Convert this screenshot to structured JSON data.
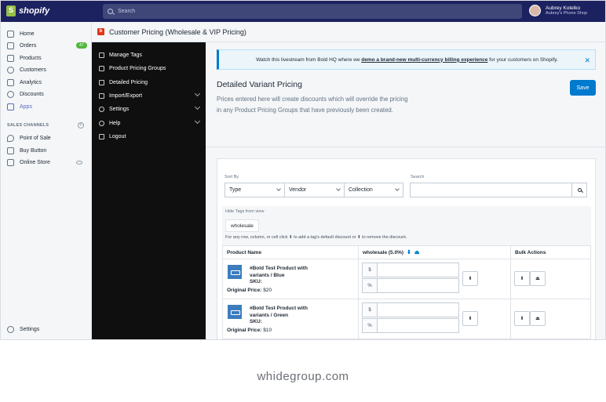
{
  "topbar": {
    "brand": "shopify",
    "search_placeholder": "Search",
    "user_name": "Aubrey Kotelko",
    "user_shop": "Aubrey's Phone Shop"
  },
  "nav": {
    "items": [
      {
        "label": "Home"
      },
      {
        "label": "Orders",
        "badge": "47"
      },
      {
        "label": "Products"
      },
      {
        "label": "Customers"
      },
      {
        "label": "Analytics"
      },
      {
        "label": "Discounts"
      },
      {
        "label": "Apps"
      }
    ],
    "channels_heading": "SALES CHANNELS",
    "channels": [
      {
        "label": "Point of Sale"
      },
      {
        "label": "Buy Button"
      },
      {
        "label": "Online Store"
      }
    ],
    "settings": "Settings"
  },
  "app": {
    "title": "Customer Pricing (Wholesale & VIP Pricing)",
    "icon_letter": "b"
  },
  "sidebar": {
    "items": [
      {
        "label": "Manage Tags"
      },
      {
        "label": "Product Pricing Groups"
      },
      {
        "label": "Detailed Pricing"
      },
      {
        "label": "Import/Export"
      },
      {
        "label": "Settings"
      },
      {
        "label": "Help"
      },
      {
        "label": "Logout"
      }
    ]
  },
  "banner": {
    "prefix": "Watch this livestream from Bold HQ where we ",
    "link": "demo a brand-new multi-currency billing experience",
    "suffix": " for your customers on Shopify."
  },
  "page": {
    "title": "Detailed Variant Pricing",
    "description": "Prices entered here will create discounts which will override the pricing in any Product Pricing Groups that have previously been created.",
    "save_label": "Save"
  },
  "filters": {
    "sort_by_label": "Sort By",
    "search_label": "Search",
    "type": "Type",
    "vendor": "Vendor",
    "collection": "Collection",
    "hide_tags_label": "Hide Tags from view",
    "tag": "wholesale",
    "hint": "For any row, column, or cell click ⬇ to add a tag's default discount or ⬆ to remove the discount."
  },
  "table": {
    "headers": [
      "Product Name",
      "wholesale (5.0%)",
      "Bulk Actions"
    ],
    "rows": [
      {
        "name": "#Bold Test Product with variants / Blue",
        "sku": "SKU:",
        "orig_label": "Original Price:",
        "price": "$20"
      },
      {
        "name": "#Bold Test Product with variants / Green",
        "sku": "SKU:",
        "orig_label": "Original Price:",
        "price": "$10"
      }
    ],
    "prefix_dollar": "$",
    "prefix_percent": "%"
  },
  "footer": {
    "brand": "whidegroup.com"
  }
}
